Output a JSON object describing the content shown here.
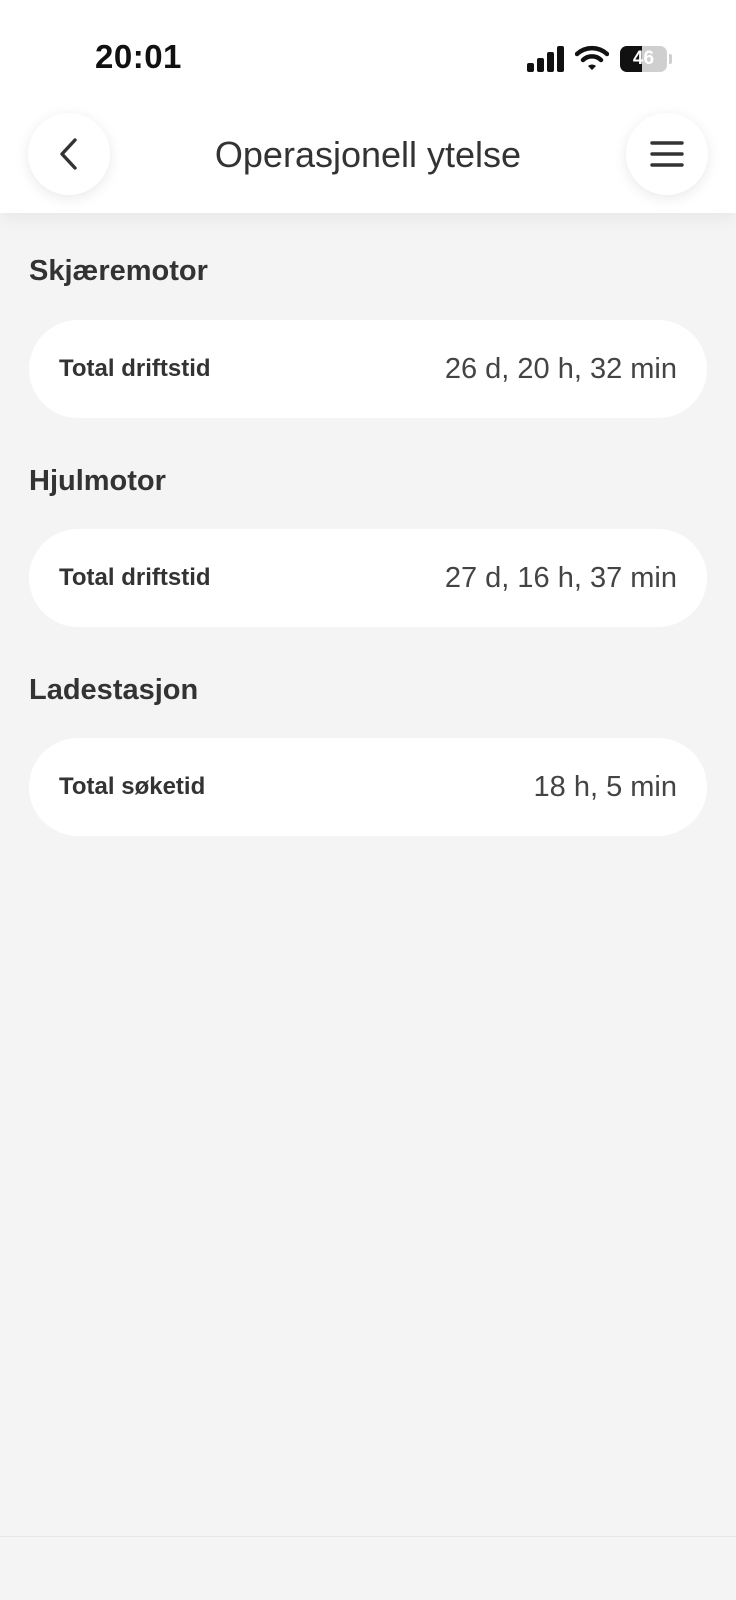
{
  "status_bar": {
    "time": "20:01",
    "battery_level": "46",
    "signal_icon": "cellular-signal-icon",
    "wifi_icon": "wifi-icon",
    "battery_icon": "battery-icon"
  },
  "header": {
    "title": "Operasjonell ytelse",
    "back_icon": "chevron-left-icon",
    "menu_icon": "hamburger-menu-icon"
  },
  "sections": [
    {
      "title": "Skjæremotor",
      "label": "Total driftstid",
      "value": "26 d, 20 h, 32 min"
    },
    {
      "title": "Hjulmotor",
      "label": "Total driftstid",
      "value": "27 d, 16 h, 37 min"
    },
    {
      "title": "Ladestasjon",
      "label": "Total søketid",
      "value": "18 h, 5 min"
    }
  ],
  "colors": {
    "background": "#f4f4f4",
    "card": "#ffffff",
    "text": "#333333"
  }
}
